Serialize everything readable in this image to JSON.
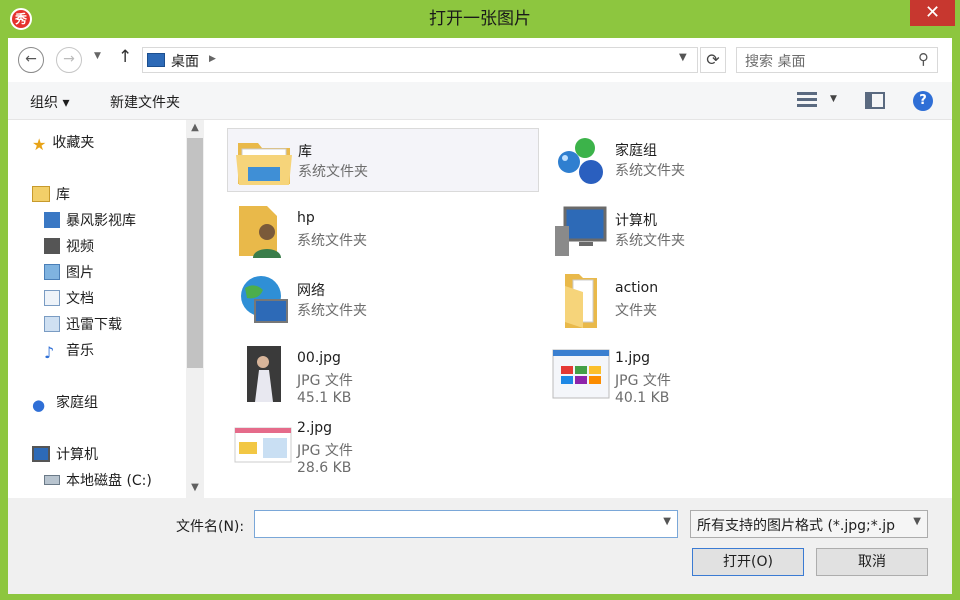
{
  "window": {
    "app_icon_char": "秀",
    "title": "打开一张图片",
    "close_glyph": "✕"
  },
  "nav": {
    "back_glyph": "←",
    "forward_glyph": "→",
    "up_glyph": "↑",
    "address": "桌面",
    "refresh_glyph": "⟳",
    "search_placeholder": "搜索 桌面"
  },
  "command_bar": {
    "organize": "组织 ▾",
    "new_folder": "新建文件夹"
  },
  "sidebar": {
    "favorites": "收藏夹",
    "libraries": "库",
    "lib_items": [
      "暴风影视库",
      "视频",
      "图片",
      "文档",
      "迅雷下载",
      "音乐"
    ],
    "homegroup": "家庭组",
    "computer": "计算机",
    "local_disk": "本地磁盘 (C:)"
  },
  "items": [
    {
      "name": "库",
      "type": "系统文件夹",
      "icon": "library-folder-icon"
    },
    {
      "name": "家庭组",
      "type": "系统文件夹",
      "icon": "homegroup-icon"
    },
    {
      "name": "hp",
      "type": "系统文件夹",
      "icon": "user-folder-icon"
    },
    {
      "name": "计算机",
      "type": "系统文件夹",
      "icon": "computer-icon"
    },
    {
      "name": "网络",
      "type": "系统文件夹",
      "icon": "network-icon"
    },
    {
      "name": "action",
      "type": "文件夹",
      "icon": "folder-icon"
    },
    {
      "name": "00.jpg",
      "type": "JPG 文件",
      "size": "45.1 KB",
      "icon": "photo-thumbnail-icon"
    },
    {
      "name": "1.jpg",
      "type": "JPG 文件",
      "size": "40.1 KB",
      "icon": "screenshot-thumbnail-icon"
    },
    {
      "name": "2.jpg",
      "type": "JPG 文件",
      "size": "28.6 KB",
      "icon": "web-thumbnail-icon"
    }
  ],
  "bottom": {
    "filename_label": "文件名(N):",
    "filename_value": "",
    "filter": "所有支持的图片格式 (*.jpg;*.jp",
    "open_button": "打开(O)",
    "cancel_button": "取消"
  },
  "colors": {
    "window_frame": "#8dc63f",
    "close_button": "#c7372f",
    "selected_tile": "#f4f4f9"
  }
}
